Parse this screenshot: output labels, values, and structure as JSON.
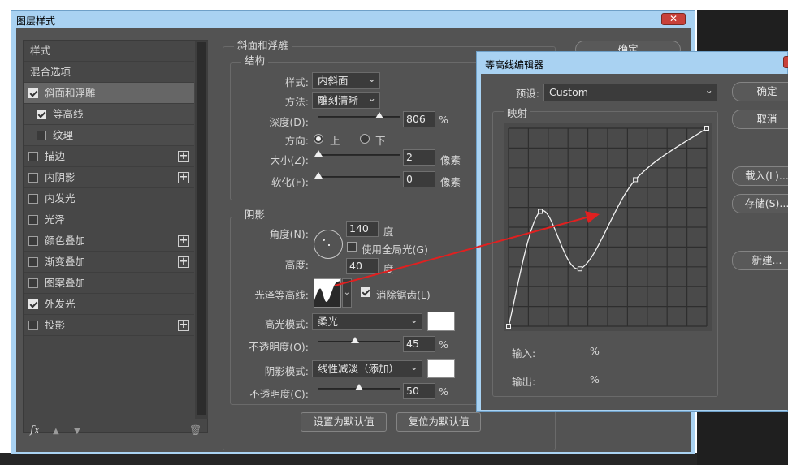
{
  "main_window": {
    "title": "图层样式",
    "close_label": "✕"
  },
  "styles_list": {
    "items": [
      {
        "label": "样式",
        "has_checkbox": false,
        "checked": false,
        "has_plus": false
      },
      {
        "label": "混合选项",
        "has_checkbox": false,
        "checked": false,
        "has_plus": false
      },
      {
        "label": "斜面和浮雕",
        "has_checkbox": true,
        "checked": true,
        "has_plus": false,
        "selected": true
      },
      {
        "label": "等高线",
        "has_checkbox": true,
        "checked": true,
        "has_plus": false,
        "sub": true
      },
      {
        "label": "纹理",
        "has_checkbox": true,
        "checked": false,
        "has_plus": false,
        "sub": true
      },
      {
        "label": "描边",
        "has_checkbox": true,
        "checked": false,
        "has_plus": true
      },
      {
        "label": "内阴影",
        "has_checkbox": true,
        "checked": false,
        "has_plus": true
      },
      {
        "label": "内发光",
        "has_checkbox": true,
        "checked": false,
        "has_plus": false
      },
      {
        "label": "光泽",
        "has_checkbox": true,
        "checked": false,
        "has_plus": false
      },
      {
        "label": "颜色叠加",
        "has_checkbox": true,
        "checked": false,
        "has_plus": true
      },
      {
        "label": "渐变叠加",
        "has_checkbox": true,
        "checked": false,
        "has_plus": true
      },
      {
        "label": "图案叠加",
        "has_checkbox": true,
        "checked": false,
        "has_plus": false
      },
      {
        "label": "外发光",
        "has_checkbox": true,
        "checked": true,
        "has_plus": false
      },
      {
        "label": "投影",
        "has_checkbox": true,
        "checked": false,
        "has_plus": true
      }
    ],
    "fx_label": "fx",
    "up_icon": "▲",
    "down_icon": "▼",
    "trash_icon": "🗑"
  },
  "bevel": {
    "group_title": "斜面和浮雕",
    "structure_title": "结构",
    "style_label": "样式:",
    "style_value": "内斜面",
    "technique_label": "方法:",
    "technique_value": "雕刻清晰",
    "depth_label": "深度(D):",
    "depth_value": "806",
    "depth_unit": "%",
    "depth_slider": 0.75,
    "direction_label": "方向:",
    "direction_up": "上",
    "direction_down": "下",
    "size_label": "大小(Z):",
    "size_value": "2",
    "size_unit": "像素",
    "size_slider": 0.0,
    "soften_label": "软化(F):",
    "soften_value": "0",
    "soften_unit": "像素",
    "soften_slider": 0.0
  },
  "shading": {
    "group_title": "阴影",
    "angle_label": "角度(N):",
    "angle_value": "140",
    "angle_unit": "度",
    "global_light_label": "使用全局光(G)",
    "altitude_label": "高度:",
    "altitude_value": "40",
    "altitude_unit": "度",
    "gloss_contour_label": "光泽等高线:",
    "anti_alias_label": "消除锯齿(L)",
    "highlight_mode_label": "高光模式:",
    "highlight_mode_value": "柔光",
    "highlight_color": "#ffffff",
    "highlight_opacity_label": "不透明度(O):",
    "highlight_opacity_value": "45",
    "highlight_opacity_unit": "%",
    "highlight_opacity_slider": 0.45,
    "shadow_mode_label": "阴影模式:",
    "shadow_mode_value": "线性减淡（添加）",
    "shadow_color": "#ffffff",
    "shadow_opacity_label": "不透明度(C):",
    "shadow_opacity_value": "50",
    "shadow_opacity_unit": "%",
    "shadow_opacity_slider": 0.5
  },
  "footer": {
    "make_default": "设置为默认值",
    "reset_default": "复位为默认值"
  },
  "main_ok_label": "确定",
  "contour_editor": {
    "title": "等高线编辑器",
    "preset_label": "预设:",
    "preset_value": "Custom",
    "mapping_title": "映射",
    "input_label": "输入:",
    "input_unit": "%",
    "output_label": "输出:",
    "output_unit": "%",
    "ok": "确定",
    "cancel": "取消",
    "load": "载入(L)...",
    "save": "存储(S)...",
    "new": "新建...",
    "close_label": "✕",
    "points": [
      [
        0,
        0
      ],
      [
        0.16,
        0.58
      ],
      [
        0.36,
        0.29
      ],
      [
        0.64,
        0.74
      ],
      [
        1,
        1
      ]
    ]
  },
  "colors": {
    "panel_bg": "#535353",
    "window_frame": "#a9d2f2",
    "arrow": "#e02020"
  }
}
